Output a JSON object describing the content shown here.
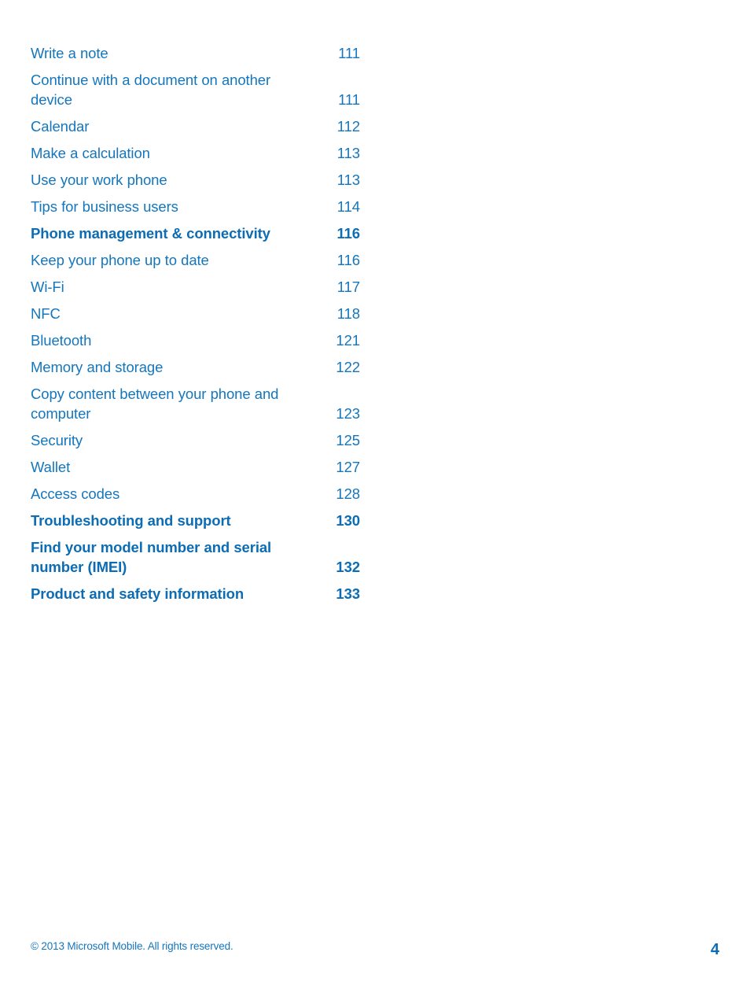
{
  "document": {
    "type": "table-of-contents",
    "text_color": "#1476bd",
    "heading_color": "#0c6cb4",
    "background_color": "#ffffff"
  },
  "toc": {
    "entries": [
      {
        "title": "Write a note",
        "page": "111",
        "bold": false
      },
      {
        "title": "Continue with a document on another device",
        "page": "111",
        "bold": false
      },
      {
        "title": "Calendar",
        "page": "112",
        "bold": false
      },
      {
        "title": "Make a calculation",
        "page": "113",
        "bold": false
      },
      {
        "title": "Use your work phone",
        "page": "113",
        "bold": false
      },
      {
        "title": "Tips for business users",
        "page": "114",
        "bold": false
      },
      {
        "title": "Phone management & connectivity",
        "page": "116",
        "bold": true
      },
      {
        "title": "Keep your phone up to date",
        "page": "116",
        "bold": false
      },
      {
        "title": "Wi-Fi",
        "page": "117",
        "bold": false
      },
      {
        "title": "NFC",
        "page": "118",
        "bold": false
      },
      {
        "title": "Bluetooth",
        "page": "121",
        "bold": false
      },
      {
        "title": "Memory and storage",
        "page": "122",
        "bold": false
      },
      {
        "title": "Copy content between your phone and computer",
        "page": "123",
        "bold": false
      },
      {
        "title": "Security",
        "page": "125",
        "bold": false
      },
      {
        "title": "Wallet",
        "page": "127",
        "bold": false
      },
      {
        "title": "Access codes",
        "page": "128",
        "bold": false
      },
      {
        "title": "Troubleshooting and support",
        "page": "130",
        "bold": true
      },
      {
        "title": "Find your model number and serial number (IMEI)",
        "page": "132",
        "bold": true
      },
      {
        "title": "Product and safety information",
        "page": "133",
        "bold": true
      }
    ]
  },
  "footer": {
    "copyright": "© 2013 Microsoft Mobile. All rights reserved.",
    "page_number": "4"
  }
}
